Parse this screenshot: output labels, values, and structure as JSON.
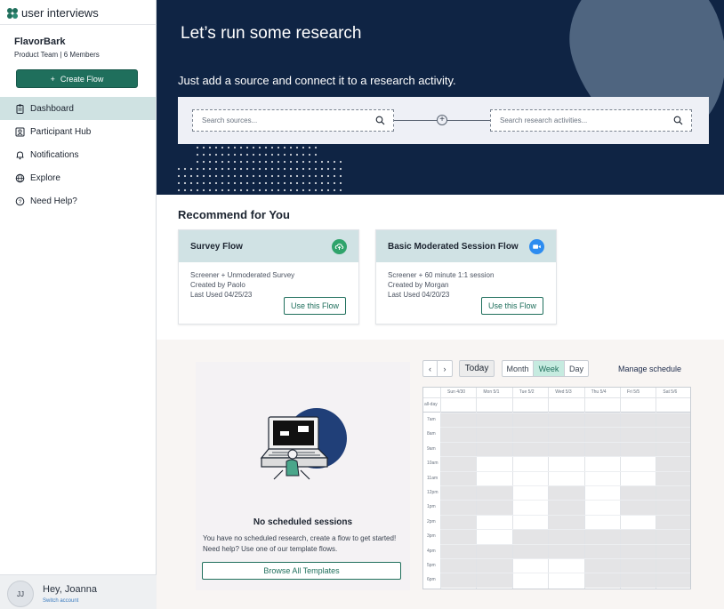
{
  "app": {
    "brand": "user interviews"
  },
  "sidebar": {
    "team_name": "FlavorBark",
    "team_sub": "Product Team | 6 Members",
    "create_label": "Create Flow",
    "items": [
      {
        "label": "Dashboard",
        "icon": "clipboard-icon",
        "active": true
      },
      {
        "label": "Participant Hub",
        "icon": "person-card-icon",
        "active": false
      },
      {
        "label": "Notifications",
        "icon": "bell-icon",
        "active": false
      },
      {
        "label": "Explore",
        "icon": "globe-icon",
        "active": false
      },
      {
        "label": "Need Help?",
        "icon": "help-icon",
        "active": false
      }
    ],
    "user": {
      "initials": "JJ",
      "greeting": "Hey, Joanna",
      "switch_label": "Switch account"
    }
  },
  "hero": {
    "title": "Let’s run some research",
    "subtitle": "Just add a source and connect it to a research activity.",
    "source_placeholder": "Search sources...",
    "activity_placeholder": "Search research activities..."
  },
  "recommend": {
    "title": "Recommend for You",
    "cards": [
      {
        "title": "Survey Flow",
        "line1": "Screener + Unmoderated Survey",
        "line2": "Created by Paolo",
        "line3": "Last Used 04/25/23",
        "button": "Use this Flow",
        "badge_icon": "cloud-sync-icon",
        "badge_color": "#2fa36b"
      },
      {
        "title": "Basic Moderated Session Flow",
        "line1": "Screener + 60 minute 1:1 session",
        "line2": "Created by Morgan",
        "line3": "Last Used 04/20/23",
        "button": "Use this Flow",
        "badge_icon": "video-camera-icon",
        "badge_color": "#2d8cf0"
      }
    ]
  },
  "sessions": {
    "empty_title": "No scheduled sessions",
    "empty_desc": "You have no scheduled research, create a flow to get started! Need help? Use one of our template flows.",
    "browse_label": "Browse All Templates"
  },
  "calendar": {
    "prev": "‹",
    "next": "›",
    "today": "Today",
    "views": [
      "Month",
      "Week",
      "Day"
    ],
    "active_view": "Week",
    "manage_label": "Manage schedule",
    "days": [
      "Sun 4/30",
      "Mon 5/1",
      "Tue 5/2",
      "Wed 5/3",
      "Thu 5/4",
      "Fri 5/5",
      "Sat 5/6"
    ],
    "allday_label": "all-day",
    "times": [
      "7am",
      "8am",
      "9am",
      "10am",
      "11am",
      "12pm",
      "1pm",
      "2pm",
      "3pm",
      "4pm",
      "5pm",
      "6pm"
    ]
  },
  "colors": {
    "brand_green": "#1f6f5c",
    "hero_navy": "#0f2444",
    "active_nav": "#cfe2e2",
    "week_active": "#c6ebe0"
  }
}
